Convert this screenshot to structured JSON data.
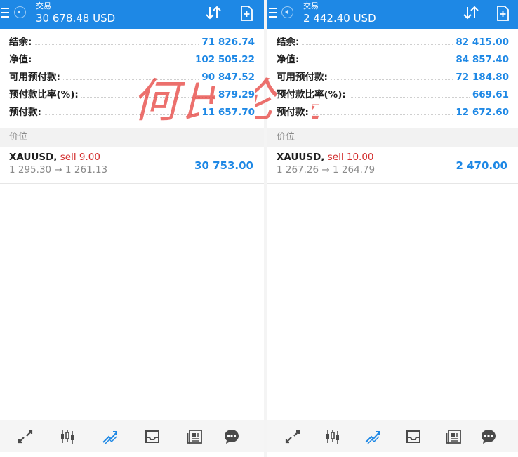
{
  "colors": {
    "accent": "#1e88e5",
    "sell": "#d32f2f",
    "watermark": "#e53935"
  },
  "screens": [
    {
      "header": {
        "subtitle": "交易",
        "title": "30 678.48 USD"
      },
      "rows": [
        {
          "label": "结余:",
          "value": "71 826.74"
        },
        {
          "label": "净值:",
          "value": "102 505.22"
        },
        {
          "label": "可用预付款:",
          "value": "90 847.52"
        },
        {
          "label": "预付款比率(%):",
          "value": "879.29"
        },
        {
          "label": "预付款:",
          "value": "11 657.70"
        }
      ],
      "section_label": "价位",
      "position": {
        "symbol": "XAUUSD,",
        "side": "sell 9.00",
        "prices": "1 295.30 → 1 261.13",
        "profit": "30 753.00"
      }
    },
    {
      "header": {
        "subtitle": "交易",
        "title": "2 442.40 USD"
      },
      "rows": [
        {
          "label": "结余:",
          "value": "82 415.00"
        },
        {
          "label": "净值:",
          "value": "84 857.40"
        },
        {
          "label": "可用预付款:",
          "value": "72 184.80"
        },
        {
          "label": "预付款比率(%):",
          "value": "669.61"
        },
        {
          "label": "预付款:",
          "value": "12 672.60"
        }
      ],
      "section_label": "价位",
      "position": {
        "symbol": "XAUUSD,",
        "side": "sell 10.00",
        "prices": "1 267.26 → 1 264.79",
        "profit": "2 470.00"
      }
    }
  ],
  "nav_icons": [
    "quotes-icon",
    "chart-icon",
    "trade-icon",
    "history-icon",
    "news-icon",
    "chat-icon"
  ],
  "watermark_text": "何氏论金"
}
